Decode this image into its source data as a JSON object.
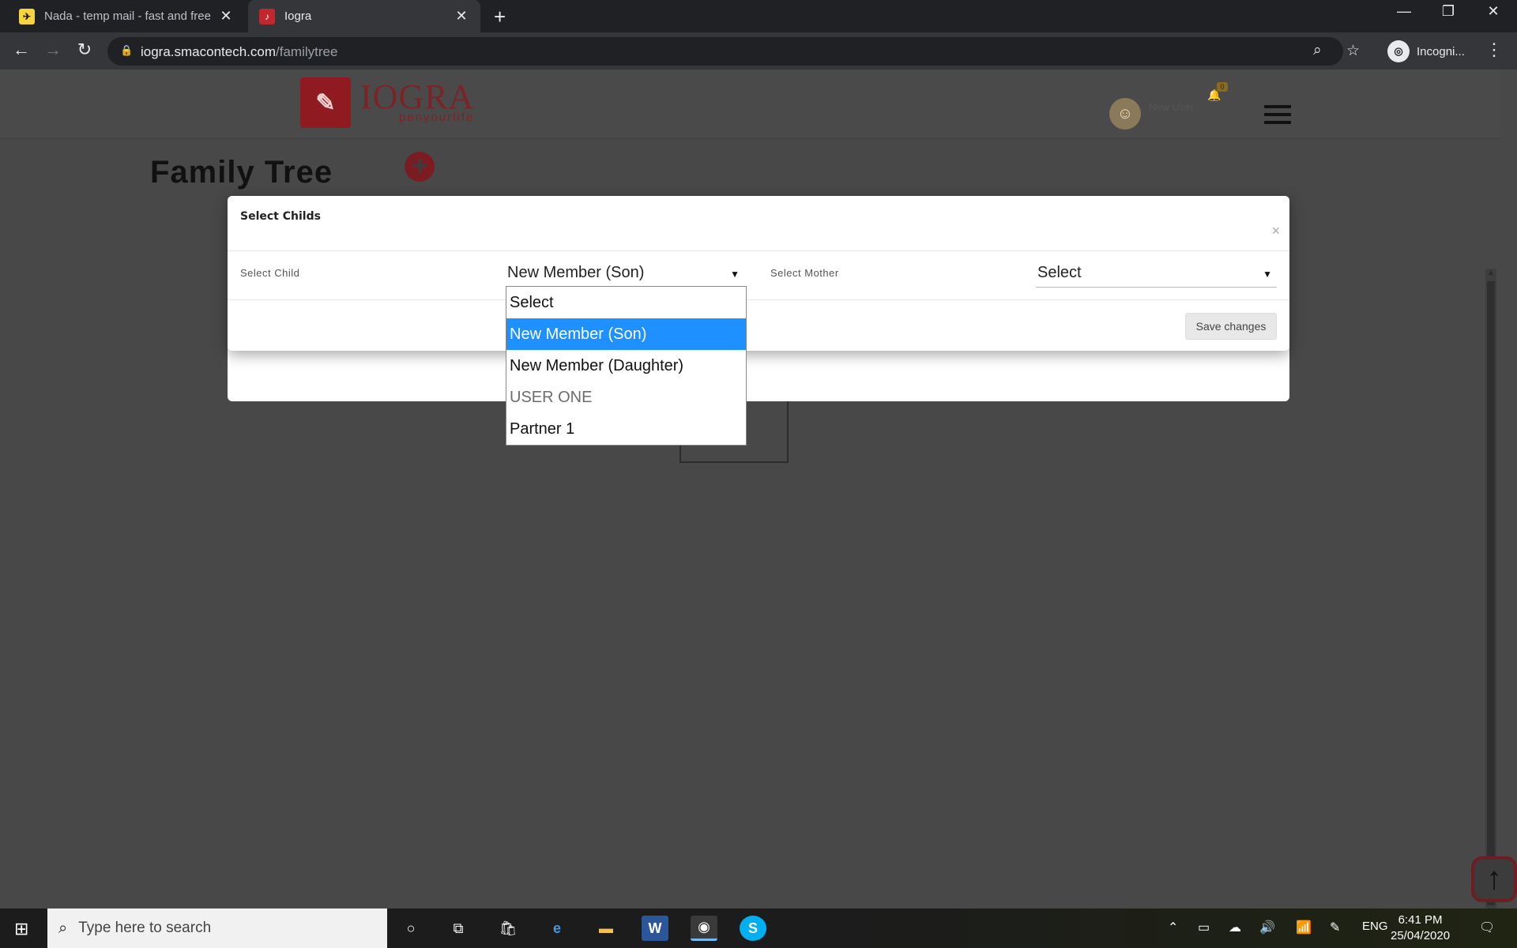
{
  "browser": {
    "tabs": [
      {
        "title": "Nada - temp mail - fast and free",
        "icon": "nada-favicon",
        "active": false
      },
      {
        "title": "Iogra",
        "icon": "iogra-favicon",
        "active": true
      }
    ],
    "url_host": "iogra.smacontech.com",
    "url_path": "/familytree",
    "profile_label": "Incogni..."
  },
  "site": {
    "logo_text": "IOGRA",
    "logo_tagline": "penyourlife",
    "user_name": "New User",
    "notification_count": "0",
    "page_title": "Family Tree",
    "add_symbol": "+"
  },
  "modal": {
    "title": "Select Childs",
    "close_symbol": "×",
    "child_label": "Select Child",
    "child_value": "New Member (Son)",
    "mother_label": "Select Mother",
    "mother_value": "Select",
    "save_label": "Save changes"
  },
  "dropdown": {
    "options": [
      {
        "label": "Select",
        "state": "normal"
      },
      {
        "label": "New Member (Son)",
        "state": "selected"
      },
      {
        "label": "New Member (Daughter)",
        "state": "normal"
      },
      {
        "label": "USER ONE",
        "state": "disabled"
      },
      {
        "label": "Partner 1",
        "state": "normal"
      }
    ]
  },
  "taskbar": {
    "search_placeholder": "Type here to search",
    "language": "ENG",
    "time": "6:41 PM",
    "date": "25/04/2020"
  },
  "colors": {
    "selected_option": "#1e90ff",
    "brand": "#c1272d"
  }
}
